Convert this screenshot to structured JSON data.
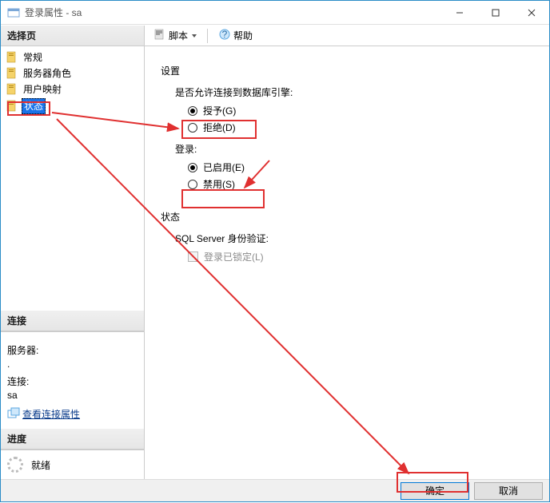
{
  "window": {
    "title": "登录属性 - sa",
    "minimize": "minimize",
    "maximize": "maximize",
    "close": "close"
  },
  "left": {
    "select_page_header": "选择页",
    "items": [
      {
        "label": "常规"
      },
      {
        "label": "服务器角色"
      },
      {
        "label": "用户映射"
      },
      {
        "label": "状态",
        "selected": true
      }
    ],
    "connection_header": "连接",
    "server_label": "服务器:",
    "server_value": ".",
    "conn_label": "连接:",
    "conn_value": "sa",
    "view_conn_props": "查看连接属性",
    "progress_header": "进度",
    "ready": "就绪"
  },
  "toolbar": {
    "script_label": "脚本",
    "help_label": "帮助"
  },
  "content": {
    "settings_title": "设置",
    "perm_label": "是否允许连接到数据库引擎:",
    "perm_grant": "授予(G)",
    "perm_deny": "拒绝(D)",
    "login_label": "登录:",
    "login_enabled": "已启用(E)",
    "login_disabled": "禁用(S)",
    "status_title": "状态",
    "sqlauth_label": "SQL Server 身份验证:",
    "lockout": "登录已锁定(L)"
  },
  "buttons": {
    "ok": "确定",
    "cancel": "取消"
  }
}
